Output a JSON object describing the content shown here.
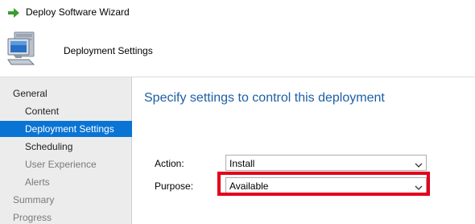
{
  "window": {
    "title": "Deploy Software Wizard",
    "title_icon": "green-arrow-icon"
  },
  "header": {
    "heading": "Deployment Settings",
    "icon": "computer-icon"
  },
  "sidebar": {
    "items": [
      {
        "label": "General",
        "level": 0,
        "state": "normal"
      },
      {
        "label": "Content",
        "level": 1,
        "state": "normal"
      },
      {
        "label": "Deployment Settings",
        "level": 1,
        "state": "selected"
      },
      {
        "label": "Scheduling",
        "level": 1,
        "state": "normal"
      },
      {
        "label": "User Experience",
        "level": 1,
        "state": "disabled"
      },
      {
        "label": "Alerts",
        "level": 1,
        "state": "disabled"
      },
      {
        "label": "Summary",
        "level": 0,
        "state": "disabled"
      },
      {
        "label": "Progress",
        "level": 0,
        "state": "disabled"
      }
    ]
  },
  "main": {
    "heading": "Specify settings to control this deployment",
    "action": {
      "label": "Action:",
      "value": "Install"
    },
    "purpose": {
      "label": "Purpose:",
      "value": "Available"
    }
  },
  "colors": {
    "selected_bg": "#0a74d4",
    "heading_text": "#1d5fa6",
    "highlight_border": "#e3001b",
    "arrow_green": "#3a9c2e"
  }
}
